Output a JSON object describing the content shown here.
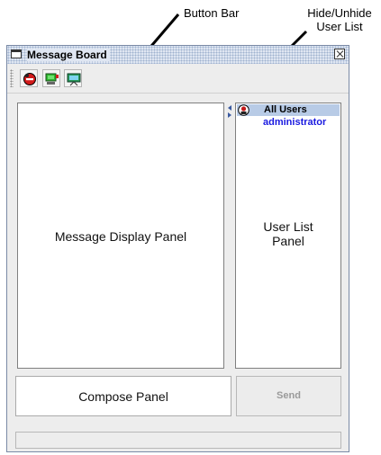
{
  "annotations": {
    "button_bar": "Button Bar",
    "hide_unhide": "Hide/Unhide",
    "user_list": "User List"
  },
  "window": {
    "title": "Message Board",
    "close_icon": "close-icon"
  },
  "toolbar": {
    "buttons": [
      {
        "icon": "red-stop-icon"
      },
      {
        "icon": "green-screen-icon"
      },
      {
        "icon": "presentation-icon"
      }
    ]
  },
  "panels": {
    "display_label": "Message Display Panel",
    "userlist_line1": "User List",
    "userlist_line2": "Panel",
    "compose_label": "Compose Panel",
    "send_label": "Send"
  },
  "user_list": {
    "header": "All Users",
    "users": [
      "administrator"
    ]
  },
  "colors": {
    "accent": "#3a5aa0",
    "user_link": "#1a1ae0",
    "header_bg": "#b8cbe6"
  }
}
